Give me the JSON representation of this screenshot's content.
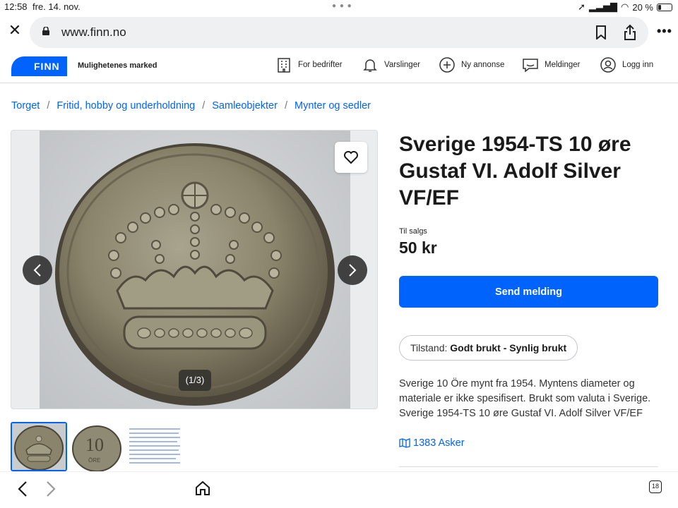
{
  "status": {
    "time": "12:58",
    "date": "fre. 14. nov.",
    "battery": "20 %"
  },
  "browser": {
    "url": "www.finn.no",
    "tab_count": "18"
  },
  "header": {
    "logo_text": "FINN",
    "tagline": "Mulighetenes marked",
    "nav": [
      {
        "label": "For bedrifter",
        "icon": "building-icon"
      },
      {
        "label": "Varslinger",
        "icon": "bell-icon"
      },
      {
        "label": "Ny annonse",
        "icon": "plus-circle-icon"
      },
      {
        "label": "Meldinger",
        "icon": "chat-icon"
      },
      {
        "label": "Logg inn",
        "icon": "user-icon"
      }
    ]
  },
  "breadcrumb": [
    "Torget",
    "Fritid, hobby og underholdning",
    "Samleobjekter",
    "Mynter og sedler"
  ],
  "gallery": {
    "counter": "(1/3)",
    "thumb_coin_text": "10",
    "thumb_coin_sub": "ÖRE"
  },
  "listing": {
    "title": "Sverige 1954-TS 10 øre Gustaf VI. Adolf Silver VF/EF",
    "price_label": "Til salgs",
    "price": "50 kr",
    "send_button": "Send melding",
    "condition_label": "Tilstand:",
    "condition_value": "Godt brukt - Synlig brukt",
    "description": "Sverige 10 Öre mynt fra 1954. Myntens diameter og materiale er ikke spesifisert. Brukt som valuta i Sverige. Sverige 1954-TS 10 øre Gustaf VI. Adolf Silver VF/EF",
    "location": "1383 Asker"
  },
  "colors": {
    "brand": "#0063fb",
    "text": "#1a1a1a"
  }
}
